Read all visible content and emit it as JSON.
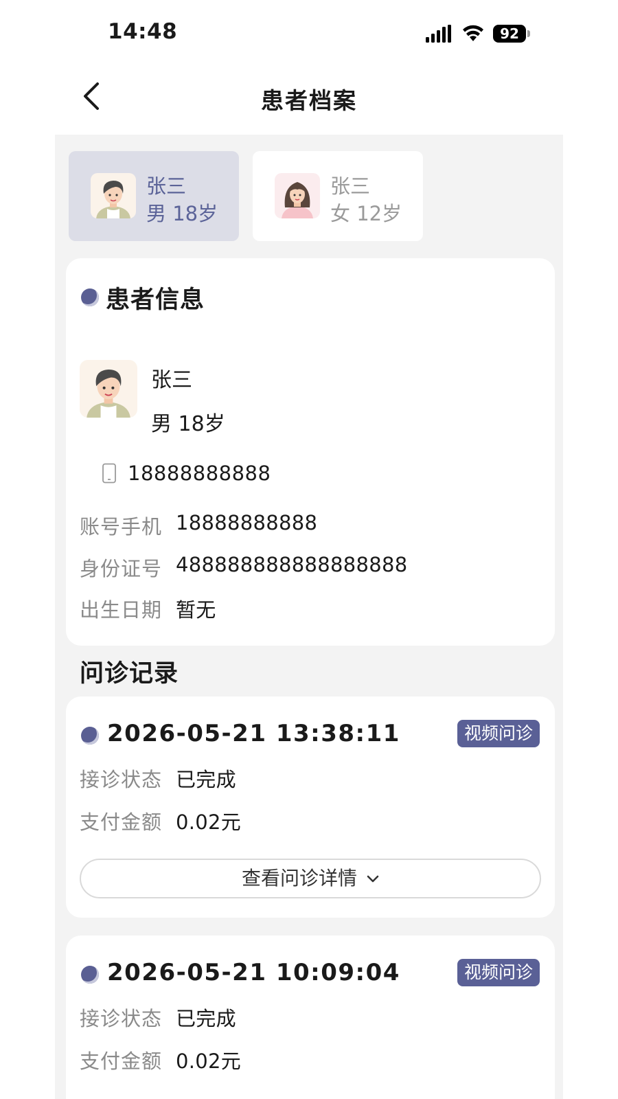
{
  "status_bar": {
    "time": "14:48",
    "battery": "92"
  },
  "header": {
    "title": "患者档案"
  },
  "patient_tabs": [
    {
      "name": "张三",
      "info": "男 18岁",
      "selected": true
    },
    {
      "name": "张三",
      "info": "女 12岁",
      "selected": false
    }
  ],
  "patient_info": {
    "section_title": "患者信息",
    "name": "张三",
    "gender_age": "男 18岁",
    "phone": "18888888888",
    "fields": [
      {
        "label": "账号手机",
        "value": "18888888888"
      },
      {
        "label": "身份证号",
        "value": "488888888888888888"
      },
      {
        "label": "出生日期",
        "value": "暂无"
      }
    ]
  },
  "records": {
    "section_title": "问诊记录",
    "items": [
      {
        "time": "2026-05-21 13:38:11",
        "badge": "视频问诊",
        "status_label": "接诊状态",
        "status": "已完成",
        "amount_label": "支付金额",
        "amount": "0.02元",
        "detail_label": "查看问诊详情"
      },
      {
        "time": "2026-05-21 10:09:04",
        "badge": "视频问诊",
        "status_label": "接诊状态",
        "status": "已完成",
        "amount_label": "支付金额",
        "amount": "0.02元"
      }
    ]
  },
  "colors": {
    "accent": "#5a6096",
    "selected_tab": "#dcdde7",
    "page_bg": "#f3f3f3"
  }
}
